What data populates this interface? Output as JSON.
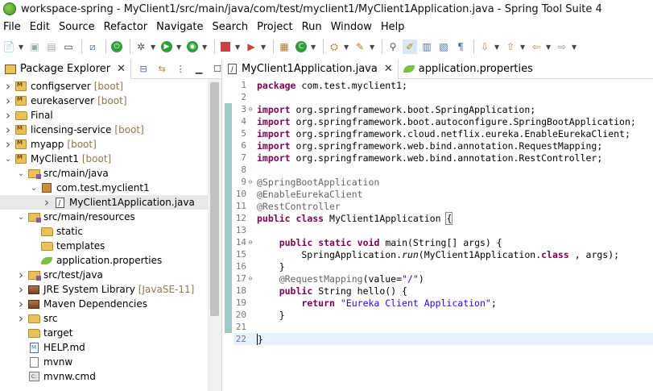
{
  "window": {
    "title": "workspace-spring - MyClient1/src/main/java/com/test/myclient1/MyClient1Application.java - Spring Tool Suite 4"
  },
  "menu": [
    "File",
    "Edit",
    "Source",
    "Refactor",
    "Navigate",
    "Search",
    "Project",
    "Run",
    "Window",
    "Help"
  ],
  "explorer": {
    "tab_label": "Package Explorer",
    "tree": [
      {
        "depth": 0,
        "twisty": ">",
        "icon": "maven-project-icon",
        "label": "configserver",
        "deco": "[boot]"
      },
      {
        "depth": 0,
        "twisty": ">",
        "icon": "maven-project-icon",
        "label": "eurekaserver",
        "deco": "[boot]"
      },
      {
        "depth": 0,
        "twisty": ">",
        "icon": "folder-icon",
        "label": "Final",
        "deco": ""
      },
      {
        "depth": 0,
        "twisty": ">",
        "icon": "maven-project-icon",
        "label": "licensing-service",
        "deco": "[boot]"
      },
      {
        "depth": 0,
        "twisty": ">",
        "icon": "maven-project-icon",
        "label": "myapp",
        "deco": "[boot]"
      },
      {
        "depth": 0,
        "twisty": "v",
        "icon": "maven-project-icon",
        "label": "MyClient1",
        "deco": "[boot]"
      },
      {
        "depth": 1,
        "twisty": "v",
        "icon": "source-folder-icon",
        "label": "src/main/java",
        "deco": ""
      },
      {
        "depth": 2,
        "twisty": "v",
        "icon": "package-icon",
        "label": "com.test.myclient1",
        "deco": ""
      },
      {
        "depth": 3,
        "twisty": ">",
        "icon": "java-file-icon",
        "label": "MyClient1Application.java",
        "deco": "",
        "selected": true
      },
      {
        "depth": 1,
        "twisty": "v",
        "icon": "source-folder-icon",
        "label": "src/main/resources",
        "deco": ""
      },
      {
        "depth": 2,
        "twisty": "",
        "icon": "folder-icon",
        "label": "static",
        "deco": ""
      },
      {
        "depth": 2,
        "twisty": "",
        "icon": "folder-icon",
        "label": "templates",
        "deco": ""
      },
      {
        "depth": 2,
        "twisty": "",
        "icon": "properties-file-icon",
        "label": "application.properties",
        "deco": ""
      },
      {
        "depth": 1,
        "twisty": ">",
        "icon": "source-folder-icon",
        "label": "src/test/java",
        "deco": ""
      },
      {
        "depth": 1,
        "twisty": ">",
        "icon": "library-icon",
        "label": "JRE System Library",
        "deco": "[JavaSE-11]"
      },
      {
        "depth": 1,
        "twisty": ">",
        "icon": "library-icon",
        "label": "Maven Dependencies",
        "deco": ""
      },
      {
        "depth": 1,
        "twisty": ">",
        "icon": "folder-icon",
        "label": "src",
        "deco": ""
      },
      {
        "depth": 1,
        "twisty": "",
        "icon": "folder-icon",
        "label": "target",
        "deco": ""
      },
      {
        "depth": 1,
        "twisty": "",
        "icon": "markdown-file-icon",
        "label": "HELP.md",
        "deco": ""
      },
      {
        "depth": 1,
        "twisty": "",
        "icon": "file-icon",
        "label": "mvnw",
        "deco": ""
      },
      {
        "depth": 1,
        "twisty": "",
        "icon": "cmd-file-icon",
        "label": "mvnw.cmd",
        "deco": ""
      }
    ]
  },
  "editor": {
    "tabs": [
      {
        "label": "MyClient1Application.java",
        "icon": "java-file-icon",
        "active": true
      },
      {
        "label": "application.properties",
        "icon": "properties-file-icon",
        "active": false
      }
    ],
    "lines": [
      {
        "n": "1",
        "fold": "",
        "parts": [
          [
            "kw",
            "package"
          ],
          [
            "",
            "com.test.myclient1;"
          ]
        ]
      },
      {
        "n": "2",
        "fold": "",
        "parts": []
      },
      {
        "n": "3",
        "fold": "⊖",
        "parts": [
          [
            "kw",
            "import"
          ],
          [
            "",
            "org.springframework.boot.SpringApplication;"
          ]
        ]
      },
      {
        "n": "4",
        "fold": "",
        "parts": [
          [
            "kw",
            "import"
          ],
          [
            "",
            "org.springframework.boot.autoconfigure.SpringBootApplication;"
          ]
        ]
      },
      {
        "n": "5",
        "fold": "",
        "parts": [
          [
            "kw",
            "import"
          ],
          [
            "",
            "org.springframework.cloud.netflix.eureka.EnableEurekaClient;"
          ]
        ]
      },
      {
        "n": "6",
        "fold": "",
        "parts": [
          [
            "kw",
            "import"
          ],
          [
            "",
            "org.springframework.web.bind.annotation.RequestMapping;"
          ]
        ]
      },
      {
        "n": "7",
        "fold": "",
        "parts": [
          [
            "kw",
            "import"
          ],
          [
            "",
            "org.springframework.web.bind.annotation.RestController;"
          ]
        ]
      },
      {
        "n": "8",
        "fold": "",
        "parts": []
      },
      {
        "n": "9",
        "fold": "⊖",
        "parts": [
          [
            "ann",
            "@SpringBootApplication"
          ]
        ]
      },
      {
        "n": "10",
        "fold": "",
        "parts": [
          [
            "ann",
            "@EnableEurekaClient"
          ]
        ]
      },
      {
        "n": "11",
        "fold": "",
        "parts": [
          [
            "ann",
            "@RestController"
          ]
        ]
      },
      {
        "n": "12",
        "fold": "",
        "parts": [
          [
            "kw",
            "public"
          ],
          [
            "kw",
            "class"
          ],
          [
            "",
            "MyClient1Application"
          ],
          [
            "br",
            "{"
          ]
        ]
      },
      {
        "n": "13",
        "fold": "",
        "parts": []
      },
      {
        "n": "14",
        "fold": "⊖",
        "parts": [
          [
            "",
            "    "
          ],
          [
            "kw",
            "public"
          ],
          [
            "kw",
            "static"
          ],
          [
            "kw",
            "void"
          ],
          [
            "",
            "main(String[] args) {"
          ]
        ]
      },
      {
        "n": "15",
        "fold": "",
        "parts": [
          [
            "",
            "        SpringApplication."
          ],
          [
            "it",
            "run"
          ],
          [
            "",
            "(MyClient1Application."
          ],
          [
            "kw",
            "class"
          ],
          [
            "",
            ", args);"
          ]
        ]
      },
      {
        "n": "16",
        "fold": "",
        "parts": [
          [
            "",
            "    }"
          ]
        ]
      },
      {
        "n": "17",
        "fold": "⊖",
        "parts": [
          [
            "",
            "    "
          ],
          [
            "ann",
            "@RequestMapping"
          ],
          [
            "",
            "(value="
          ],
          [
            "str",
            "\"/\""
          ],
          [
            "",
            ")"
          ]
        ]
      },
      {
        "n": "18",
        "fold": "",
        "parts": [
          [
            "",
            "    "
          ],
          [
            "kw",
            "public"
          ],
          [
            "",
            "String hello() {"
          ]
        ]
      },
      {
        "n": "19",
        "fold": "",
        "parts": [
          [
            "",
            "        "
          ],
          [
            "kw",
            "return"
          ],
          [
            "str",
            "\"Eureka Client Application\""
          ],
          [
            "",
            ";"
          ]
        ]
      },
      {
        "n": "20",
        "fold": "",
        "parts": [
          [
            "",
            "    }"
          ]
        ]
      },
      {
        "n": "21",
        "fold": "",
        "parts": []
      },
      {
        "n": "22",
        "fold": "",
        "parts": [
          [
            "caret",
            "}"
          ]
        ],
        "current": true
      }
    ]
  }
}
